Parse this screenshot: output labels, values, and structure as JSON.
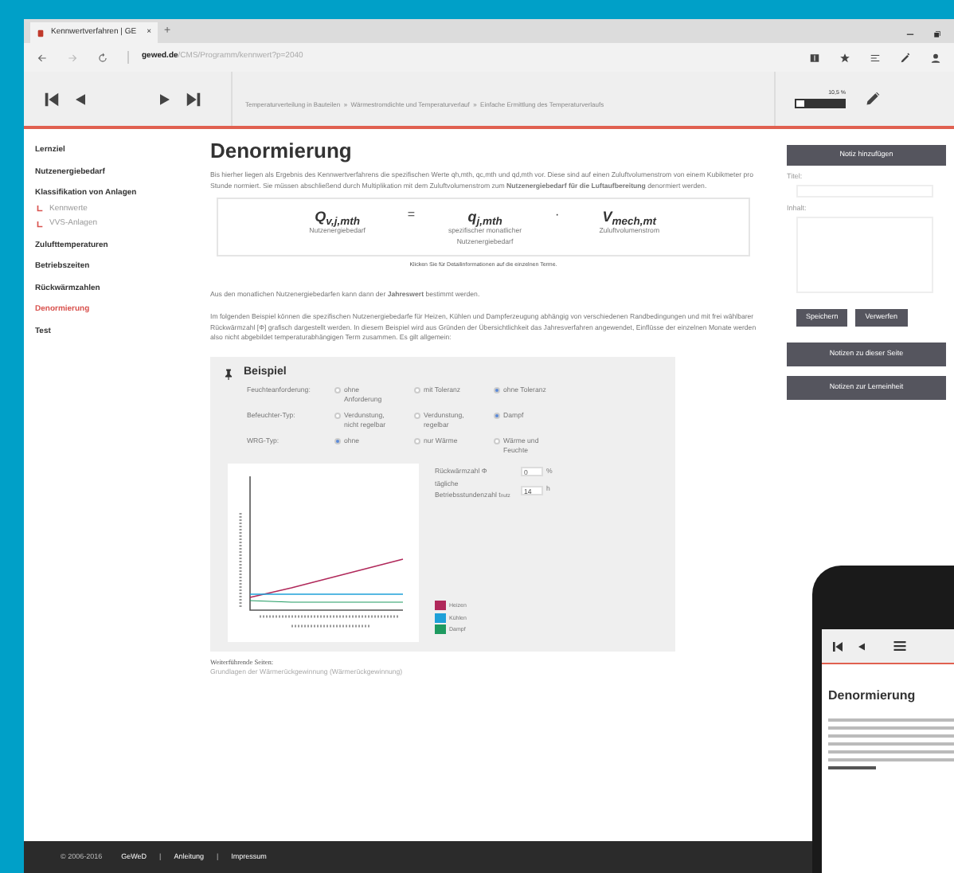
{
  "browser": {
    "tab": {
      "title": "Kennwertverfahren | GE",
      "close": "×"
    },
    "new_tab": "+",
    "url_host": "gewed.de",
    "url_path": "/CMS/Programm/kennwert?p=2040"
  },
  "toolbar": {
    "breadcrumb": "Temperaturverteilung in Bauteilen  »  Wärmestromdichte und Temperaturverlauf  »  Einfache Ermittlung des Temperaturverlaufs",
    "progress": {
      "reading": "10,5 %",
      "level": 0.15
    }
  },
  "sidebar": {
    "items": [
      {
        "label": "Lernziel",
        "selected": false
      },
      {
        "label": "Nutzenergiebedarf",
        "selected": false
      },
      {
        "label": "Klassifikation von Anlagen",
        "selected": false,
        "children": [
          {
            "label": "Kennwerte",
            "selected": false
          },
          {
            "label": "VVS-Anlagen",
            "selected": false
          }
        ]
      },
      {
        "label": "Zulufttemperaturen",
        "selected": false
      },
      {
        "label": "Betriebszeiten",
        "selected": false
      },
      {
        "label": "Rückwärmzahlen",
        "selected": false
      },
      {
        "label": "Denormierung",
        "selected": true
      },
      {
        "label": "Test",
        "selected": false
      }
    ]
  },
  "main": {
    "title": "Denormierung",
    "intro": "Bis hierher liegen als Ergebnis des Kennwertverfahrens die spezifischen Werte qh,mth, qc,mth und qd,mth vor. Diese sind auf einen Zuluftvolumenstrom von einem Kubikmeter pro Stunde normiert. Sie müssen abschließend durch Multiplikation mit dem Zuluftvolumenstrom zum **Nutzenergiebedarf für die Luftaufbereitung** denormiert werden.",
    "formula": {
      "terms": [
        {
          "symbol": "Q$_{v,j,mth}$",
          "label": "Nutzenergiebedarf"
        },
        {
          "symbol": "q$_{j,mth}$",
          "label": "spezifischer monatlicher Nutzenergiebedarf"
        },
        {
          "symbol": "V$_{mech,mt}$",
          "label": "Zuluftvolumenstrom"
        }
      ],
      "operators": [
        "=",
        "·"
      ],
      "note": "Klicken Sie für Detailinformationen auf die einzelnen Terme."
    },
    "paragraphs": [
      "Aus den monatlichen Nutzenergiebedarfen kann dann der **Jahreswert** bestimmt werden.",
      "Im folgenden Beispiel können die spezifischen Nutzenergiebedarfe für Heizen, Kühlen und Dampferzeugung abhängig von verschiedenen Randbedingungen und mit frei wählbarer Rückwärmzahl [Φ] grafisch dargestellt werden. In diesem Beispiel wird aus Gründen der Übersichtlichkeit das Jahresverfahren angewendet, Einflüsse der einzelnen Monate werden also nicht abgebildet temperaturabhängigen Term zusammen. Es gilt allgemein:"
    ],
    "example": {
      "title": "Beispiel",
      "rows": [
        {
          "label": "Feuchteanforderung:",
          "options": [
            {
              "label": "ohne Anforderung",
              "selected": false
            },
            {
              "label": "mit Toleranz",
              "selected": false
            },
            {
              "label": "ohne Toleranz",
              "selected": true
            }
          ]
        },
        {
          "label": "Befeuchter-Typ:",
          "options": [
            {
              "label": "Verdunstung, nicht regelbar",
              "selected": false
            },
            {
              "label": "Verdunstung, regelbar",
              "selected": false
            },
            {
              "label": "Dampf",
              "selected": true
            }
          ]
        },
        {
          "label": "WRG-Typ:",
          "options": [
            {
              "label": "ohne",
              "selected": true
            },
            {
              "label": "nur Wärme",
              "selected": false
            },
            {
              "label": "Wärme und Feuchte",
              "selected": false
            }
          ]
        }
      ],
      "inputs": [
        {
          "label": "Rückwärmzahl Φ",
          "value": "0",
          "unit": "%"
        },
        {
          "label": "tägliche Betriebsstundenzahl t$_{nutz}$",
          "value": "14",
          "unit": "h"
        }
      ],
      "legend": [
        {
          "label": "Heizen",
          "color": "#b0285a"
        },
        {
          "label": "Kühlen",
          "color": "#1ea0d8"
        },
        {
          "label": "Dampf",
          "color": "#1e9a60"
        }
      ]
    },
    "further": {
      "title": "Weiterführende Seiten:",
      "link": "Grundlagen der Wärmerückgewinnung (Wärmerückgewinnung)"
    }
  },
  "notes": {
    "add": "Notiz hinzufügen",
    "title_label": "Titel:",
    "content_label": "Inhalt:",
    "save": "Speichern",
    "discard": "Verwerfen",
    "page_notes": "Notizen zu dieser Seite",
    "unit_notes": "Notizen zur Lerneinheit"
  },
  "footer": {
    "copyright": "© 2006-2016",
    "links": [
      "GeWeD",
      "Anleitung",
      "Impressum"
    ],
    "separator": "|"
  },
  "phone": {
    "title": "Denormierung"
  }
}
